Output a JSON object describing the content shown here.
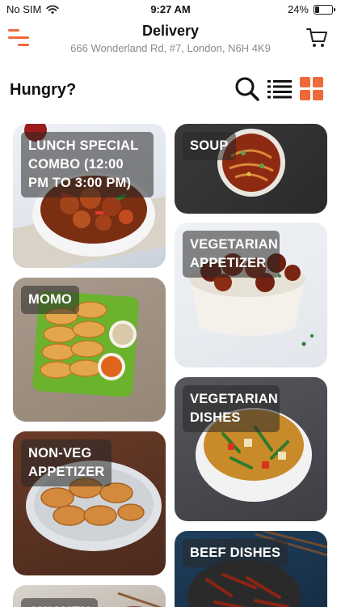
{
  "status_bar": {
    "carrier": "No SIM",
    "time": "9:27 AM",
    "battery": "24%",
    "battery_level": 0.24
  },
  "header": {
    "title": "Delivery",
    "address": "666 Wonderland Rd, #7, London, N6H 4K9"
  },
  "toolbar": {
    "heading": "Hungry?"
  },
  "categories": [
    {
      "name": "LUNCH SPECIAL COMBO (12:00 PM TO 3:00 PM)"
    },
    {
      "name": "SOUP"
    },
    {
      "name": "VEGETARIAN APPETIZER"
    },
    {
      "name": "MOMO"
    },
    {
      "name": "VEGETARIAN DISHES"
    },
    {
      "name": "NON-VEG APPETIZER"
    },
    {
      "name": "BEEF DISHES"
    },
    {
      "name": "CHICKEN"
    }
  ],
  "colors": {
    "accent": "#ee6a3a"
  },
  "icons": {
    "menu": "hamburger-menu-icon",
    "cart": "shopping-cart-icon",
    "search": "search-icon",
    "list_view": "list-view-icon",
    "grid_view": "grid-view-icon"
  }
}
